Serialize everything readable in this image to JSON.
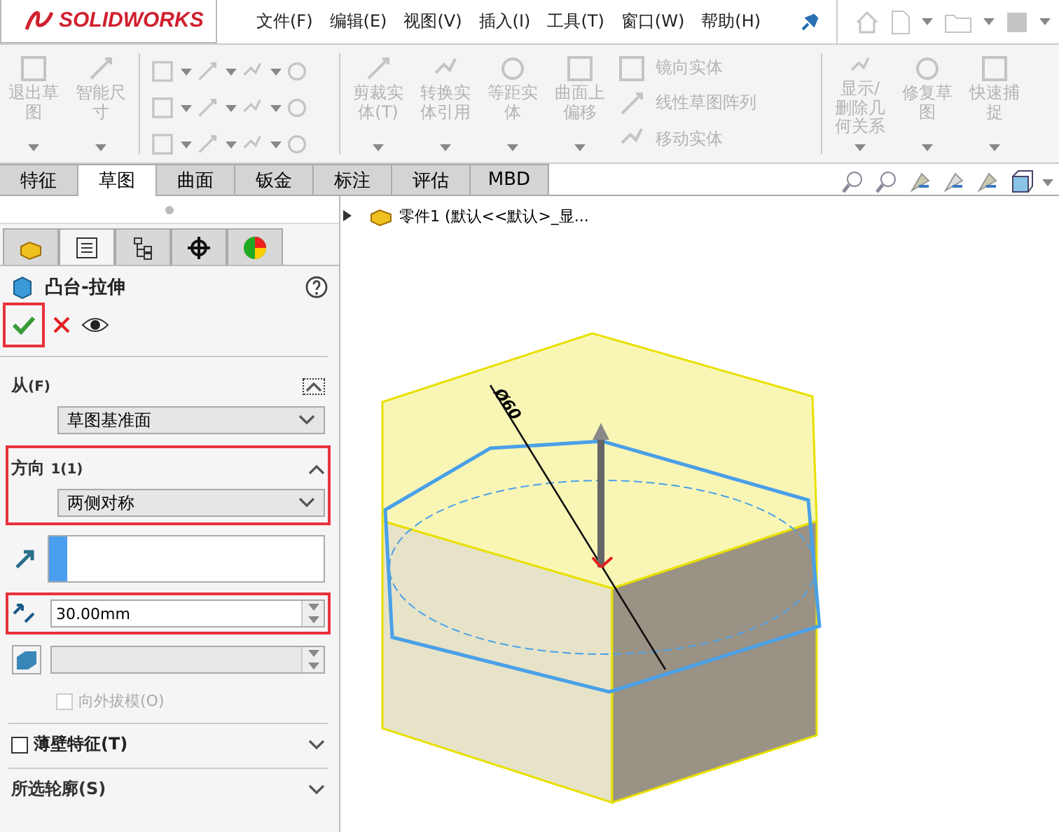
{
  "app": {
    "logo": "SOLIDWORKS",
    "menu": [
      "文件(F)",
      "编辑(E)",
      "视图(V)",
      "插入(I)",
      "工具(T)",
      "窗口(W)",
      "帮助(H)"
    ]
  },
  "ribbon": {
    "large_left": [
      {
        "label": "退出草图",
        "disabled": true
      },
      {
        "label": "智能尺寸",
        "disabled": true
      }
    ],
    "large_mid": [
      {
        "label": "剪裁实体(T)",
        "disabled": true
      },
      {
        "label": "转换实体引用",
        "disabled": true
      },
      {
        "label": "等距实体",
        "disabled": true
      },
      {
        "label": "曲面上偏移",
        "disabled": true
      }
    ],
    "list": [
      {
        "label": "镜向实体",
        "disabled": true
      },
      {
        "label": "线性草图阵列",
        "disabled": true
      },
      {
        "label": "移动实体",
        "disabled": true
      }
    ],
    "large_right": [
      {
        "label": "显示/删除几何关系",
        "disabled": true
      },
      {
        "label": "修复草图",
        "disabled": true
      },
      {
        "label": "快速捕捉",
        "disabled": true
      }
    ]
  },
  "tabs": [
    {
      "label": "特征",
      "selected": false
    },
    {
      "label": "草图",
      "selected": true
    },
    {
      "label": "曲面",
      "selected": false
    },
    {
      "label": "钣金",
      "selected": false
    },
    {
      "label": "标注",
      "selected": false
    },
    {
      "label": "评估",
      "selected": false
    },
    {
      "label": "MBD",
      "selected": false
    }
  ],
  "panel": {
    "icon_tabs": [
      {
        "selected": false
      },
      {
        "selected": true
      },
      {
        "selected": false
      },
      {
        "selected": false
      },
      {
        "selected": false
      }
    ],
    "title": "凸台-拉伸",
    "ok_highlighted": true,
    "from": {
      "label": "从",
      "key": "(F)",
      "value": "草图基准面"
    },
    "direction": {
      "label": "方向",
      "key": "1(1)",
      "value": "两侧对称",
      "highlighted": true
    },
    "depth": {
      "value": "30.00mm",
      "highlighted": true
    },
    "draft": {
      "label": "向外拔模(O)",
      "checked": false,
      "disabled": true
    },
    "thin": {
      "label": "薄壁特征(T)",
      "checked": false
    },
    "contours": {
      "label": "所选轮廓(S)"
    }
  },
  "viewport": {
    "tree_item": "零件1 (默认<<默认>_显...",
    "dimension": "Ø60"
  }
}
